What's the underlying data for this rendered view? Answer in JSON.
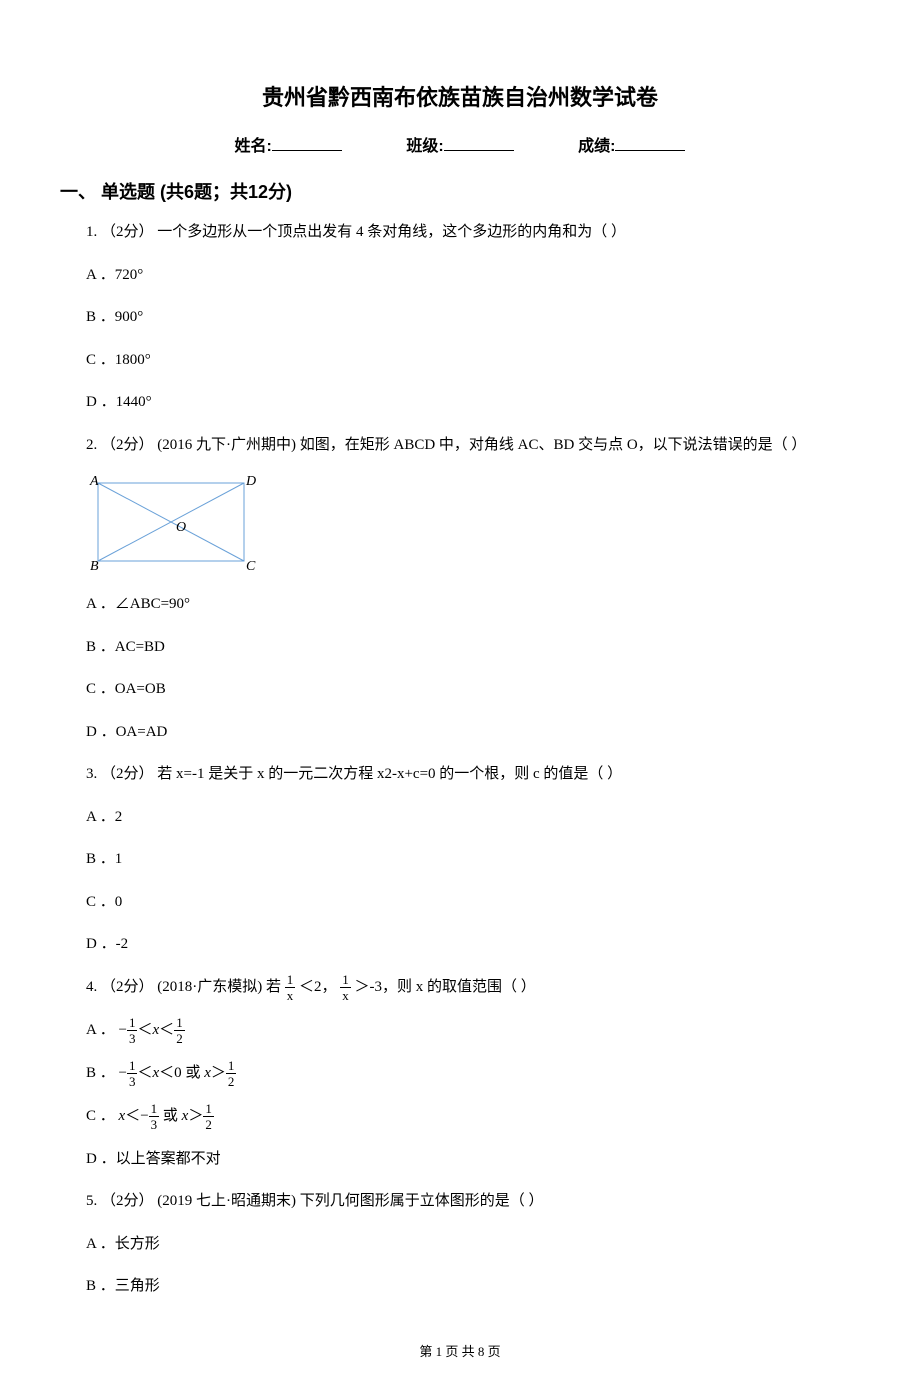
{
  "title": "贵州省黔西南布依族苗族自治州数学试卷",
  "header": {
    "name_label": "姓名:",
    "class_label": "班级:",
    "score_label": "成绩:"
  },
  "section1": {
    "header": "一、 单选题 (共6题；共12分)"
  },
  "q1": {
    "stem": "1. （2分） 一个多边形从一个顶点出发有 4 条对角线，这个多边形的内角和为（    ）",
    "A": "A ．720°",
    "B": "B ．900°",
    "C": "C ．1800°",
    "D": "D ．1440°"
  },
  "q2": {
    "stem": "2. （2分） (2016 九下·广州期中) 如图，在矩形 ABCD 中，对角线 AC、BD 交与点 O，以下说法错误的是（    ）",
    "A": "A ．∠ABC=90°",
    "B": "B ．AC=BD",
    "C": "C ．OA=OB",
    "D": "D ．OA=AD"
  },
  "q3": {
    "stem": "3. （2分） 若 x=-1 是关于 x 的一元二次方程 x2-x+c=0 的一个根，则 c 的值是（    ）",
    "A": "A ．2",
    "B": "B ．1",
    "C": "C ．0",
    "D": "D ．-2"
  },
  "q4": {
    "stem_pre": "4. （2分） (2018·广东模拟) 若",
    "stem_mid": "＜2，",
    "stem_post": "＞-3，则 x 的取值范围（    ）",
    "A_pre": "A ．",
    "B_pre": "B ．",
    "B_mid": " 或 ",
    "C_pre": "C ．",
    "C_mid": " 或 ",
    "D": "D ．以上答案都不对"
  },
  "q5": {
    "stem": "5. （2分） (2019 七上·昭通期末) 下列几何图形属于立体图形的是（    ）",
    "A": "A ．长方形",
    "B": "B ．三角形"
  },
  "footer": "第 1 页 共 8 页"
}
